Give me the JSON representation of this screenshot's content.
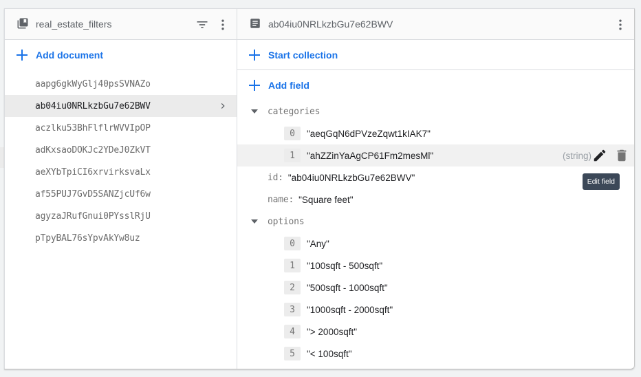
{
  "collection": {
    "name": "real_estate_filters",
    "icons": {
      "collection": "collection-icon",
      "filter": "filter-icon",
      "more": "more-vert-icon"
    },
    "add_document_label": "Add document",
    "documents": [
      {
        "id": "aapg6gkWyGlj40psSVNAZo",
        "selected": false
      },
      {
        "id": "ab04iu0NRLkzbGu7e62BWV",
        "selected": true
      },
      {
        "id": "aczlku53BhFlflrWVVIpOP",
        "selected": false
      },
      {
        "id": "adKxsaoDOKJc2YDeJ0ZkVT",
        "selected": false
      },
      {
        "id": "aeXYbTpiCI6xrvirksvaLx",
        "selected": false
      },
      {
        "id": "af55PUJ7GvD5SANZjcUf6w",
        "selected": false
      },
      {
        "id": "agyzaJRufGnui0PYsslRjU",
        "selected": false
      },
      {
        "id": "pTpyBAL76sYpvAkYw8uz",
        "selected": false
      }
    ]
  },
  "document": {
    "id": "ab04iu0NRLkzbGu7e62BWV",
    "start_collection_label": "Start collection",
    "add_field_label": "Add field",
    "fields": {
      "categories": {
        "key": "categories",
        "items": [
          {
            "index": "0",
            "value": "\"aeqGqN6dPVzeZqwt1kIAK7\""
          },
          {
            "index": "1",
            "value": "\"ahZZinYaAgCP61Fm2mesMl\"",
            "type": "(string)",
            "hovered": true
          }
        ]
      },
      "id": {
        "key": "id:",
        "value": "\"ab04iu0NRLkzbGu7e62BWV\""
      },
      "name": {
        "key": "name:",
        "value": "\"Square feet\""
      },
      "options": {
        "key": "options",
        "items": [
          {
            "index": "0",
            "value": "\"Any\""
          },
          {
            "index": "1",
            "value": "\"100sqft - 500sqft\""
          },
          {
            "index": "2",
            "value": "\"500sqft - 1000sqft\""
          },
          {
            "index": "3",
            "value": "\"1000sqft - 2000sqft\""
          },
          {
            "index": "4",
            "value": "\"> 2000sqft\""
          },
          {
            "index": "5",
            "value": "\"< 100sqft\""
          }
        ]
      }
    },
    "tooltip": "Edit field"
  },
  "colors": {
    "accent": "#1a73e8",
    "header_bg": "#fafafa",
    "selected_bg": "#ebebeb",
    "tooltip_bg": "#3c4858"
  }
}
